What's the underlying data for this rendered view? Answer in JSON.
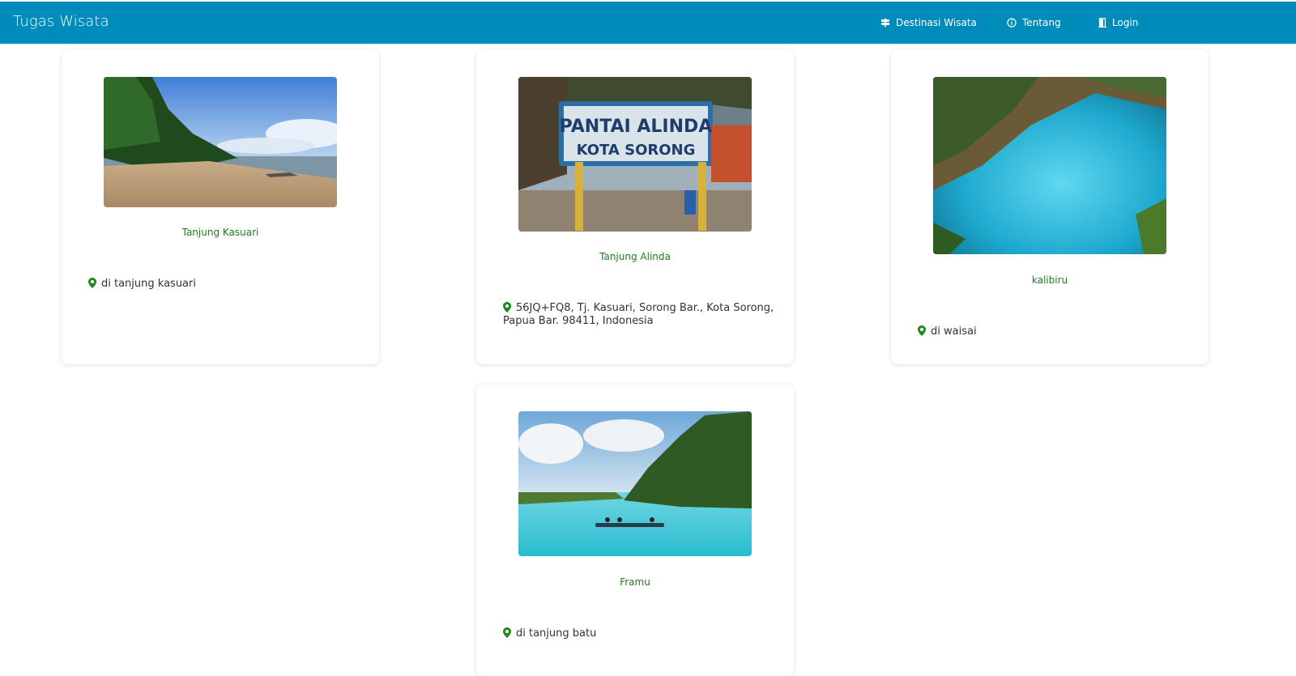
{
  "app": {
    "title": "Tugas Wisata"
  },
  "nav": {
    "items": [
      {
        "label": "Destinasi Wisata",
        "icon": "signpost-icon"
      },
      {
        "label": "Tentang",
        "icon": "info-icon"
      },
      {
        "label": "Login",
        "icon": "door-icon"
      }
    ]
  },
  "colors": {
    "navbar": "#008cba",
    "title_green": "#1e7c1e",
    "pin_green": "#1e8a1e"
  },
  "cards": [
    {
      "title": "Tanjung Kasuari",
      "location": "di tanjung kasuari",
      "image": "beach-photo"
    },
    {
      "title": "Tanjung Alinda",
      "location": "56JQ+FQ8, Tj. Kasuari, Sorong Bar., Kota Sorong, Papua Bar. 98411, Indonesia",
      "image": "pantai-alinda-sign-photo"
    },
    {
      "title": "kalibiru",
      "location": "di waisai",
      "image": "blue-river-photo"
    },
    {
      "title": "Framu",
      "location": "di tanjung batu",
      "image": "river-canoe-photo"
    }
  ]
}
